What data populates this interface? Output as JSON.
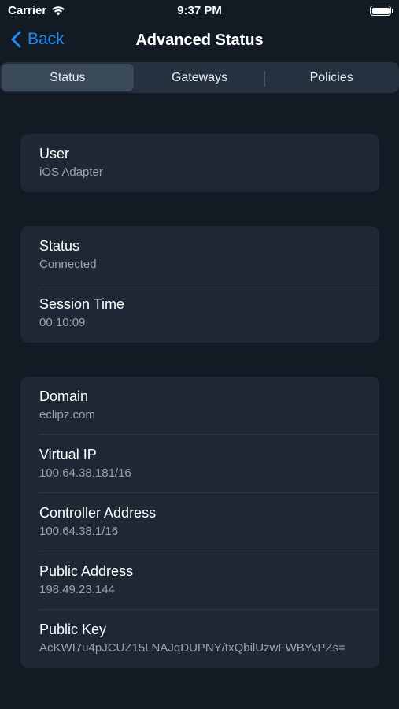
{
  "status_bar": {
    "carrier": "Carrier",
    "time": "9:37 PM"
  },
  "nav": {
    "back_label": "Back",
    "title": "Advanced Status"
  },
  "tabs": [
    {
      "label": "Status",
      "selected": true
    },
    {
      "label": "Gateways",
      "selected": false
    },
    {
      "label": "Policies",
      "selected": false
    }
  ],
  "cards": {
    "user": [
      {
        "label": "User",
        "value": "iOS Adapter"
      }
    ],
    "connection": [
      {
        "label": "Status",
        "value": "Connected"
      },
      {
        "label": "Session Time",
        "value": "00:10:09"
      }
    ],
    "network": [
      {
        "label": "Domain",
        "value": "eclipz.com"
      },
      {
        "label": "Virtual IP",
        "value": "100.64.38.181/16"
      },
      {
        "label": "Controller Address",
        "value": "100.64.38.1/16"
      },
      {
        "label": "Public Address",
        "value": "198.49.23.144"
      },
      {
        "label": "Public Key",
        "value": "AcKWI7u4pJCUZ15LNAJqDUPNY/txQbilUzwFWBYvPZs="
      }
    ]
  },
  "colors": {
    "accent": "#1e8bf3",
    "background": "#121b24",
    "card": "#1d2834"
  }
}
